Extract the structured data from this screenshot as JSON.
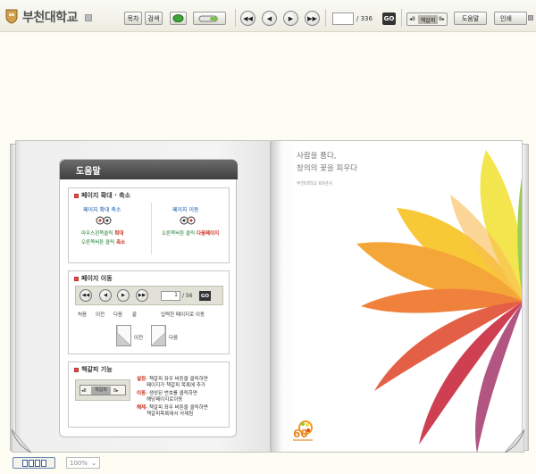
{
  "header": {
    "brand": "부천대학교",
    "btn_toc": "목차",
    "btn_search": "검색",
    "total_pages": "/ 336",
    "go_label": "GO",
    "bookmark_label": "책갈피",
    "btn_help": "도움말",
    "btn_print": "인쇄"
  },
  "help": {
    "title": "도움말",
    "zoom": {
      "title": "페이지 확대 · 축소",
      "sub_left": "페이지 확대 축소",
      "line1_a": "마우스",
      "line1_b": "왼쪽클릭",
      "line1_c": " 확대",
      "line2_a": "오른쪽",
      "line2_b": "버튼 클릭",
      "line2_c": " 축소",
      "sub_right": "페이지 이동",
      "line3_a": "오른쪽",
      "line3_b": "버튼 클릭 ",
      "line3_c": "다음페이지"
    },
    "nav": {
      "title": "페이지 이동",
      "pages": "/ 56",
      "page_value": "1",
      "go": "GO",
      "labels": [
        "처음",
        "이전",
        "다음",
        "끝"
      ],
      "input_desc": "입력한 페이지로 이동",
      "prev_page": "이전",
      "next_page": "다음"
    },
    "bookmark": {
      "title": "책갈피 기능",
      "label": "책갈피",
      "set_key": "설정",
      "set_desc1": "- 책갈피 좌우 버튼을 클릭하면",
      "set_desc2": "페이지가 책갈피 목록에 추가",
      "move_key": "이동",
      "move_desc1": "- 생성된 번호를 클릭하면",
      "move_desc2": "해당페이지로이동",
      "del_key": "해제",
      "del_desc1": "- 책갈피 좌우 버튼을 클릭하면",
      "del_desc2": "책갈피목록에서 삭제됨"
    }
  },
  "rightpage": {
    "quote_line1": "사람을 품다,",
    "quote_line2": "창의의 꽃을 피우다",
    "sub": "부천대학교 60년사",
    "anniv_number": "60"
  },
  "status": {
    "zoom": "100%"
  },
  "colors": {
    "accent_red": "#c8321e",
    "accent_blue": "#0f58a8",
    "accent_green": "#1f7e32"
  }
}
